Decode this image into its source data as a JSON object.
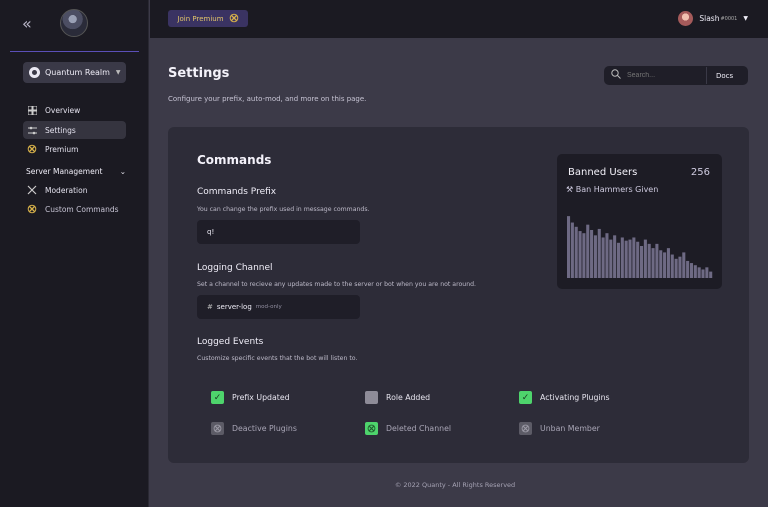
{
  "sidebar": {
    "collapse_icon": "double-chevron-left-icon",
    "server": {
      "name": "Quantum Realm"
    },
    "items": [
      {
        "label": "Overview",
        "icon": "grid-icon"
      },
      {
        "label": "Settings",
        "icon": "sliders-icon",
        "active": true
      },
      {
        "label": "Premium",
        "icon": "premium-icon"
      }
    ],
    "section": {
      "label": "Server Management"
    },
    "section_items": [
      {
        "label": "Moderation",
        "icon": "tools-icon"
      },
      {
        "label": "Custom Commands",
        "icon": "premium-icon"
      }
    ]
  },
  "topbar": {
    "premium_label": "Join Premium",
    "user": {
      "name": "Slash",
      "tag": "#0001"
    }
  },
  "main": {
    "title": "Settings",
    "subtitle": "Configure your prefix, auto-mod, and more on this page.",
    "search": {
      "placeholder": "Search...",
      "docs_label": "Docs"
    }
  },
  "card": {
    "title": "Commands",
    "prefix": {
      "label": "Commands Prefix",
      "description": "You can change the prefix used in message commands.",
      "value": "q!"
    },
    "logging": {
      "label": "Logging Channel",
      "description": "Set a channel to recieve any updates made to the server or bot when you are not around.",
      "channel": "server-log",
      "channel_note": "mod-only"
    },
    "events": {
      "label": "Logged Events",
      "description": "Customize specific events that the bot will listen to.",
      "items": [
        {
          "label": "Prefix Updated",
          "state": "checked"
        },
        {
          "label": "Role Added",
          "state": "unchecked"
        },
        {
          "label": "Activating Plugins",
          "state": "checked"
        },
        {
          "label": "Deactive Plugins",
          "state": "premium-locked"
        },
        {
          "label": "Deleted Channel",
          "state": "premium-enabled"
        },
        {
          "label": "Unban Member",
          "state": "premium-locked"
        }
      ]
    }
  },
  "banned": {
    "title": "Banned Users",
    "count": "256",
    "subtitle": "Ban Hammers Given",
    "bars": [
      58,
      52,
      48,
      44,
      42,
      50,
      45,
      40,
      46,
      38,
      42,
      36,
      40,
      33,
      38,
      35,
      36,
      38,
      34,
      30,
      36,
      32,
      28,
      32,
      26,
      24,
      28,
      22,
      18,
      20,
      24,
      16,
      14,
      12,
      10,
      8,
      10,
      6
    ]
  },
  "footer": {
    "text": "© 2022 Quanty - All Rights Reserved"
  },
  "colors": {
    "accent": "#5b4fb8",
    "premium": "#d8b24a",
    "check": "#4ed46c",
    "bars": "#6e6a84"
  }
}
